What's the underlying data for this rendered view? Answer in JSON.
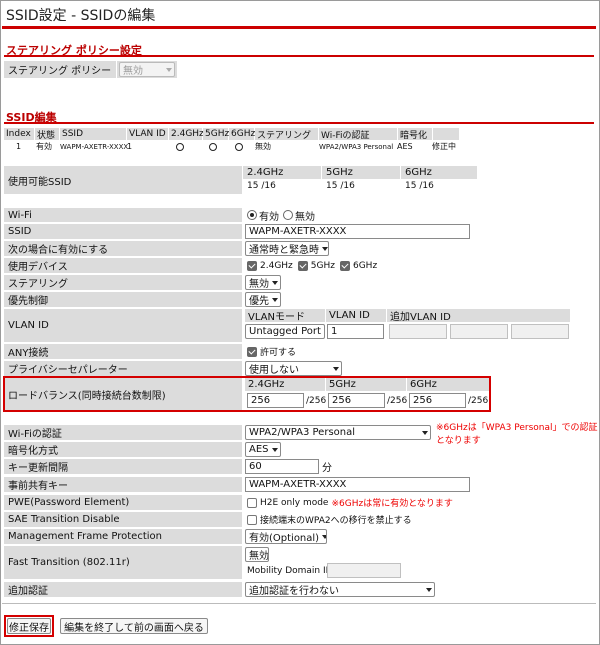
{
  "page_title": "SSID設定 - SSIDの編集",
  "steering_policy": {
    "heading": "ステアリング ポリシー設定",
    "label": "ステアリング ポリシー",
    "value": "無効"
  },
  "ssid_edit": {
    "heading": "SSID編集",
    "columns": [
      "Index",
      "状態",
      "SSID",
      "VLAN ID",
      "2.4GHz",
      "5GHz",
      "6GHz",
      "ステアリング",
      "Wi-Fiの認証",
      "暗号化"
    ],
    "row": {
      "index": "1",
      "state": "有効",
      "ssid": "WAPM-AXETR-XXXX",
      "vlan": "1",
      "steering": "無効",
      "auth": "WPA2/WPA3 Personal",
      "enc": "AES",
      "status": "修正中"
    }
  },
  "available_ssid": {
    "label": "使用可能SSID",
    "bands": [
      {
        "name": "2.4GHz",
        "value": "15 /16"
      },
      {
        "name": "5GHz",
        "value": "15 /16"
      },
      {
        "name": "6GHz",
        "value": "15 /16"
      }
    ]
  },
  "form": {
    "wifi": {
      "label": "Wi-Fi",
      "opt_on": "有効",
      "opt_off": "無効"
    },
    "ssid": {
      "label": "SSID",
      "value": "WAPM-AXETR-XXXX"
    },
    "enable_when": {
      "label": "次の場合に有効にする",
      "value": "通常時と緊急時"
    },
    "devices": {
      "label": "使用デバイス",
      "b1": "2.4GHz",
      "b2": "5GHz",
      "b3": "6GHz"
    },
    "steering": {
      "label": "ステアリング",
      "value": "無効"
    },
    "priority": {
      "label": "優先制御",
      "value": "優先"
    },
    "vlan": {
      "label": "VLAN ID",
      "mode_header": "VLANモード",
      "id_header": "VLAN ID",
      "add_header": "追加VLAN ID",
      "mode_value": "Untagged Port",
      "id_value": "1"
    },
    "any": {
      "label": "ANY接続",
      "check": "許可する"
    },
    "privacy": {
      "label": "プライバシーセパレーター",
      "value": "使用しない"
    },
    "load_balance": {
      "label": "ロードバランス(同時接続台数制限)",
      "bands": [
        {
          "name": "2.4GHz",
          "value": "256",
          "max": "/256"
        },
        {
          "name": "5GHz",
          "value": "256",
          "max": "/256"
        },
        {
          "name": "6GHz",
          "value": "256",
          "max": "/256"
        }
      ]
    },
    "auth": {
      "label": "Wi-Fiの認証",
      "value": "WPA2/WPA3 Personal",
      "note": "※6GHzは「WPA3 Personal」での認証となります"
    },
    "encryption": {
      "label": "暗号化方式",
      "value": "AES"
    },
    "key_interval": {
      "label": "キー更新間隔",
      "value": "60",
      "unit": "分"
    },
    "psk": {
      "label": "事前共有キー",
      "value": "WAPM-AXETR-XXXX"
    },
    "pwe": {
      "label": "PWE(Password Element)",
      "check": "H2E only mode",
      "note": "※6GHzは常に有効となります"
    },
    "sae": {
      "label": "SAE Transition Disable",
      "check": "接続端末のWPA2への移行を禁止する"
    },
    "mfp": {
      "label": "Management Frame Protection",
      "value": "有効(Optional)"
    },
    "ft": {
      "label": "Fast Transition (802.11r)",
      "value": "無効",
      "domain_label": "Mobility Domain ID"
    },
    "extra_auth": {
      "label": "追加認証",
      "value": "追加認証を行わない"
    }
  },
  "buttons": {
    "save": "修正保存",
    "back": "編集を終了して前の画面へ戻る"
  }
}
